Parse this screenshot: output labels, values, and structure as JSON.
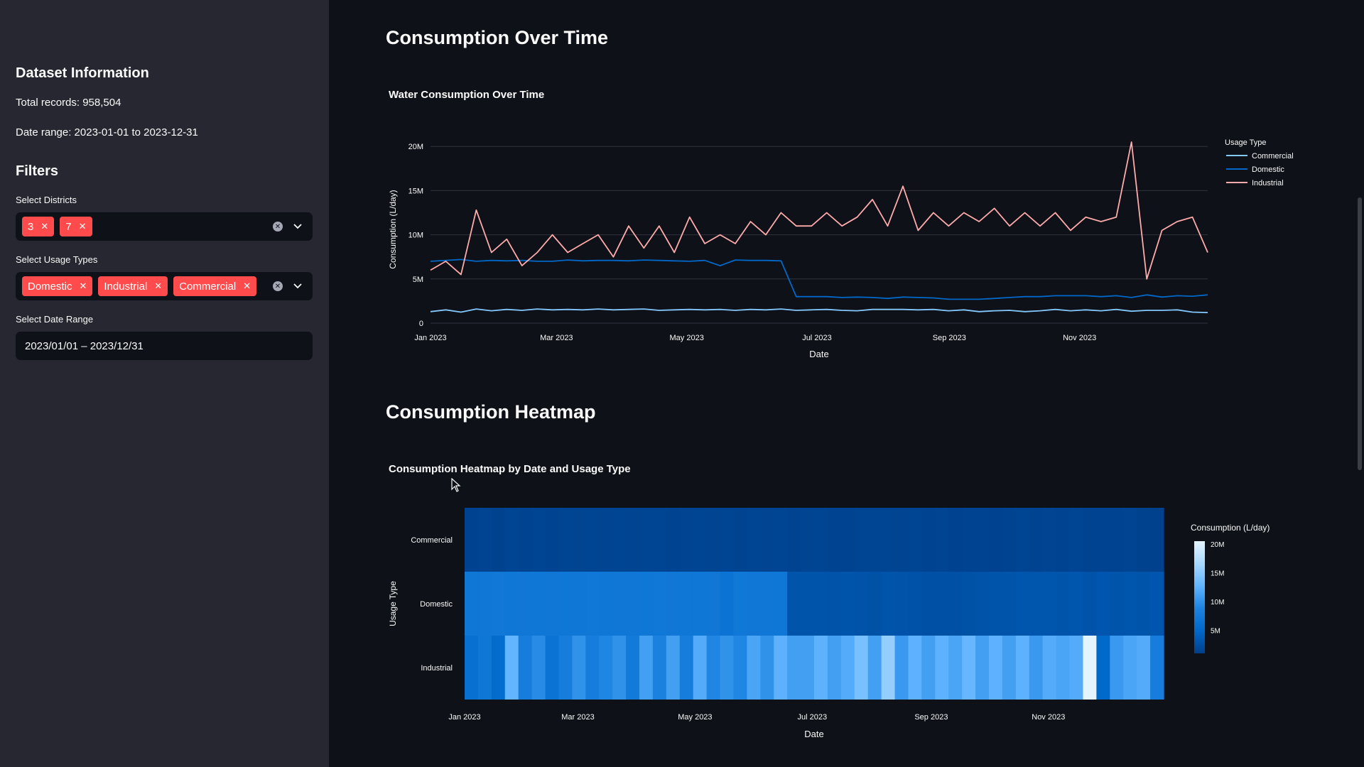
{
  "sidebar": {
    "dataset_title": "Dataset Information",
    "total_records": "Total records: 958,504",
    "date_range": "Date range: 2023-01-01 to 2023-12-31",
    "filters_title": "Filters",
    "districts_label": "Select Districts",
    "districts": [
      "3",
      "7"
    ],
    "usage_label": "Select Usage Types",
    "usage_types": [
      "Domestic",
      "Industrial",
      "Commercial"
    ],
    "date_label": "Select Date Range",
    "date_value": "2023/01/01 – 2023/12/31"
  },
  "section1": {
    "title": "Consumption Over Time"
  },
  "section2": {
    "title": "Consumption Heatmap"
  },
  "colors": {
    "commercial": "#83c9ff",
    "domestic": "#0068c9",
    "industrial": "#ffabab",
    "tag": "#ff4b4b"
  },
  "chart_data": [
    {
      "type": "line",
      "title": "Water Consumption Over Time",
      "xlabel": "Date",
      "ylabel": "Consumption (L/day)",
      "x_ticks": [
        "Jan 2023",
        "Mar 2023",
        "May 2023",
        "Jul 2023",
        "Sep 2023",
        "Nov 2023"
      ],
      "y_ticks": [
        "0",
        "5M",
        "10M",
        "15M",
        "20M"
      ],
      "ylim": [
        0,
        20500000
      ],
      "legend_title": "Usage Type",
      "legend_position": "top-right",
      "x_range": [
        "2023-01-01",
        "2023-12-31"
      ],
      "series": [
        {
          "name": "Commercial",
          "values": [
            1300000,
            1500000,
            1250000,
            1600000,
            1400000,
            1550000,
            1450000,
            1600000,
            1500000,
            1550000,
            1500000,
            1600000,
            1500000,
            1550000,
            1600000,
            1450000,
            1500000,
            1550000,
            1500000,
            1550000,
            1450000,
            1550000,
            1500000,
            1600000,
            1450000,
            1500000,
            1550000,
            1450000,
            1400000,
            1550000,
            1550000,
            1550000,
            1500000,
            1550000,
            1400000,
            1500000,
            1300000,
            1400000,
            1450000,
            1300000,
            1400000,
            1550000,
            1400000,
            1500000,
            1400000,
            1550000,
            1350000,
            1450000,
            1450000,
            1500000,
            1250000,
            1200000
          ]
        },
        {
          "name": "Domestic",
          "values": [
            7000000,
            7100000,
            7200000,
            7000000,
            7100000,
            7050000,
            7100000,
            7000000,
            7000000,
            7150000,
            7050000,
            7100000,
            7100000,
            7050000,
            7150000,
            7100000,
            7050000,
            7000000,
            7100000,
            6500000,
            7150000,
            7100000,
            7100000,
            7050000,
            3000000,
            3000000,
            3000000,
            2900000,
            2950000,
            2900000,
            2800000,
            2950000,
            2900000,
            2850000,
            2700000,
            2700000,
            2700000,
            2800000,
            2900000,
            3000000,
            3000000,
            3100000,
            3100000,
            3100000,
            3000000,
            3100000,
            2900000,
            3200000,
            2950000,
            3100000,
            3050000,
            3200000
          ]
        },
        {
          "name": "Industrial",
          "values": [
            6000000,
            7000000,
            5500000,
            12800000,
            8000000,
            9500000,
            6500000,
            8000000,
            10000000,
            8000000,
            9000000,
            10000000,
            7500000,
            11000000,
            8500000,
            11000000,
            8000000,
            12000000,
            9000000,
            10000000,
            9000000,
            11500000,
            10000000,
            12500000,
            11000000,
            11000000,
            12500000,
            11000000,
            12000000,
            14000000,
            11000000,
            15500000,
            10500000,
            12500000,
            11000000,
            12500000,
            11500000,
            13000000,
            11000000,
            12500000,
            11000000,
            12500000,
            10500000,
            12000000,
            11500000,
            12000000,
            20500000,
            5000000,
            10500000,
            11500000,
            12000000,
            8000000
          ]
        }
      ]
    },
    {
      "type": "heatmap",
      "title": "Consumption Heatmap by Date and Usage Type",
      "xlabel": "Date",
      "ylabel": "Usage Type",
      "categories": [
        "Commercial",
        "Domestic",
        "Industrial"
      ],
      "x_ticks": [
        "Jan 2023",
        "Mar 2023",
        "May 2023",
        "Jul 2023",
        "Sep 2023",
        "Nov 2023"
      ],
      "colorbar_title": "Consumption (L/day)",
      "colorbar_ticks": [
        "5M",
        "10M",
        "15M",
        "20M"
      ],
      "zlim": [
        1000000,
        20500000
      ],
      "colorscale": [
        "#003f8a",
        "#0068c9",
        "#1c83e1",
        "#60b4ff",
        "#a8d8ff",
        "#e4f5ff"
      ]
    }
  ]
}
